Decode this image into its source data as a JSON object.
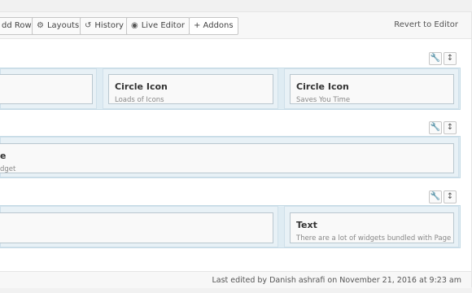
{
  "toolbar": {
    "add_row": "dd Row",
    "layouts": "Layouts",
    "history": "History",
    "live_editor": "Live Editor",
    "addons": "+ Addons",
    "revert": "Revert to Editor"
  },
  "rows": [
    {
      "widgets": [
        {
          "title": "",
          "desc": ""
        },
        {
          "title": "Circle Icon",
          "desc": "Loads of Icons"
        },
        {
          "title": "Circle Icon",
          "desc": "Saves You Time"
        }
      ]
    },
    {
      "widgets": [
        {
          "title": "e",
          "desc": "dget"
        }
      ]
    },
    {
      "widgets": [
        {
          "title": "",
          "desc": ""
        },
        {
          "title": "Text",
          "desc": "There are a lot of widgets bundled with Page"
        }
      ]
    }
  ],
  "row_controls": {
    "edit_icon": "wrench-icon",
    "move_icon": "move-icon"
  },
  "footer": {
    "last_edited": "Last edited by Danish ashrafi on November 21, 2016 at 9:23 am"
  },
  "colors": {
    "row_bg": "#dfecf3",
    "widget_border": "#b9c7cf",
    "accent": "#0073aa"
  }
}
